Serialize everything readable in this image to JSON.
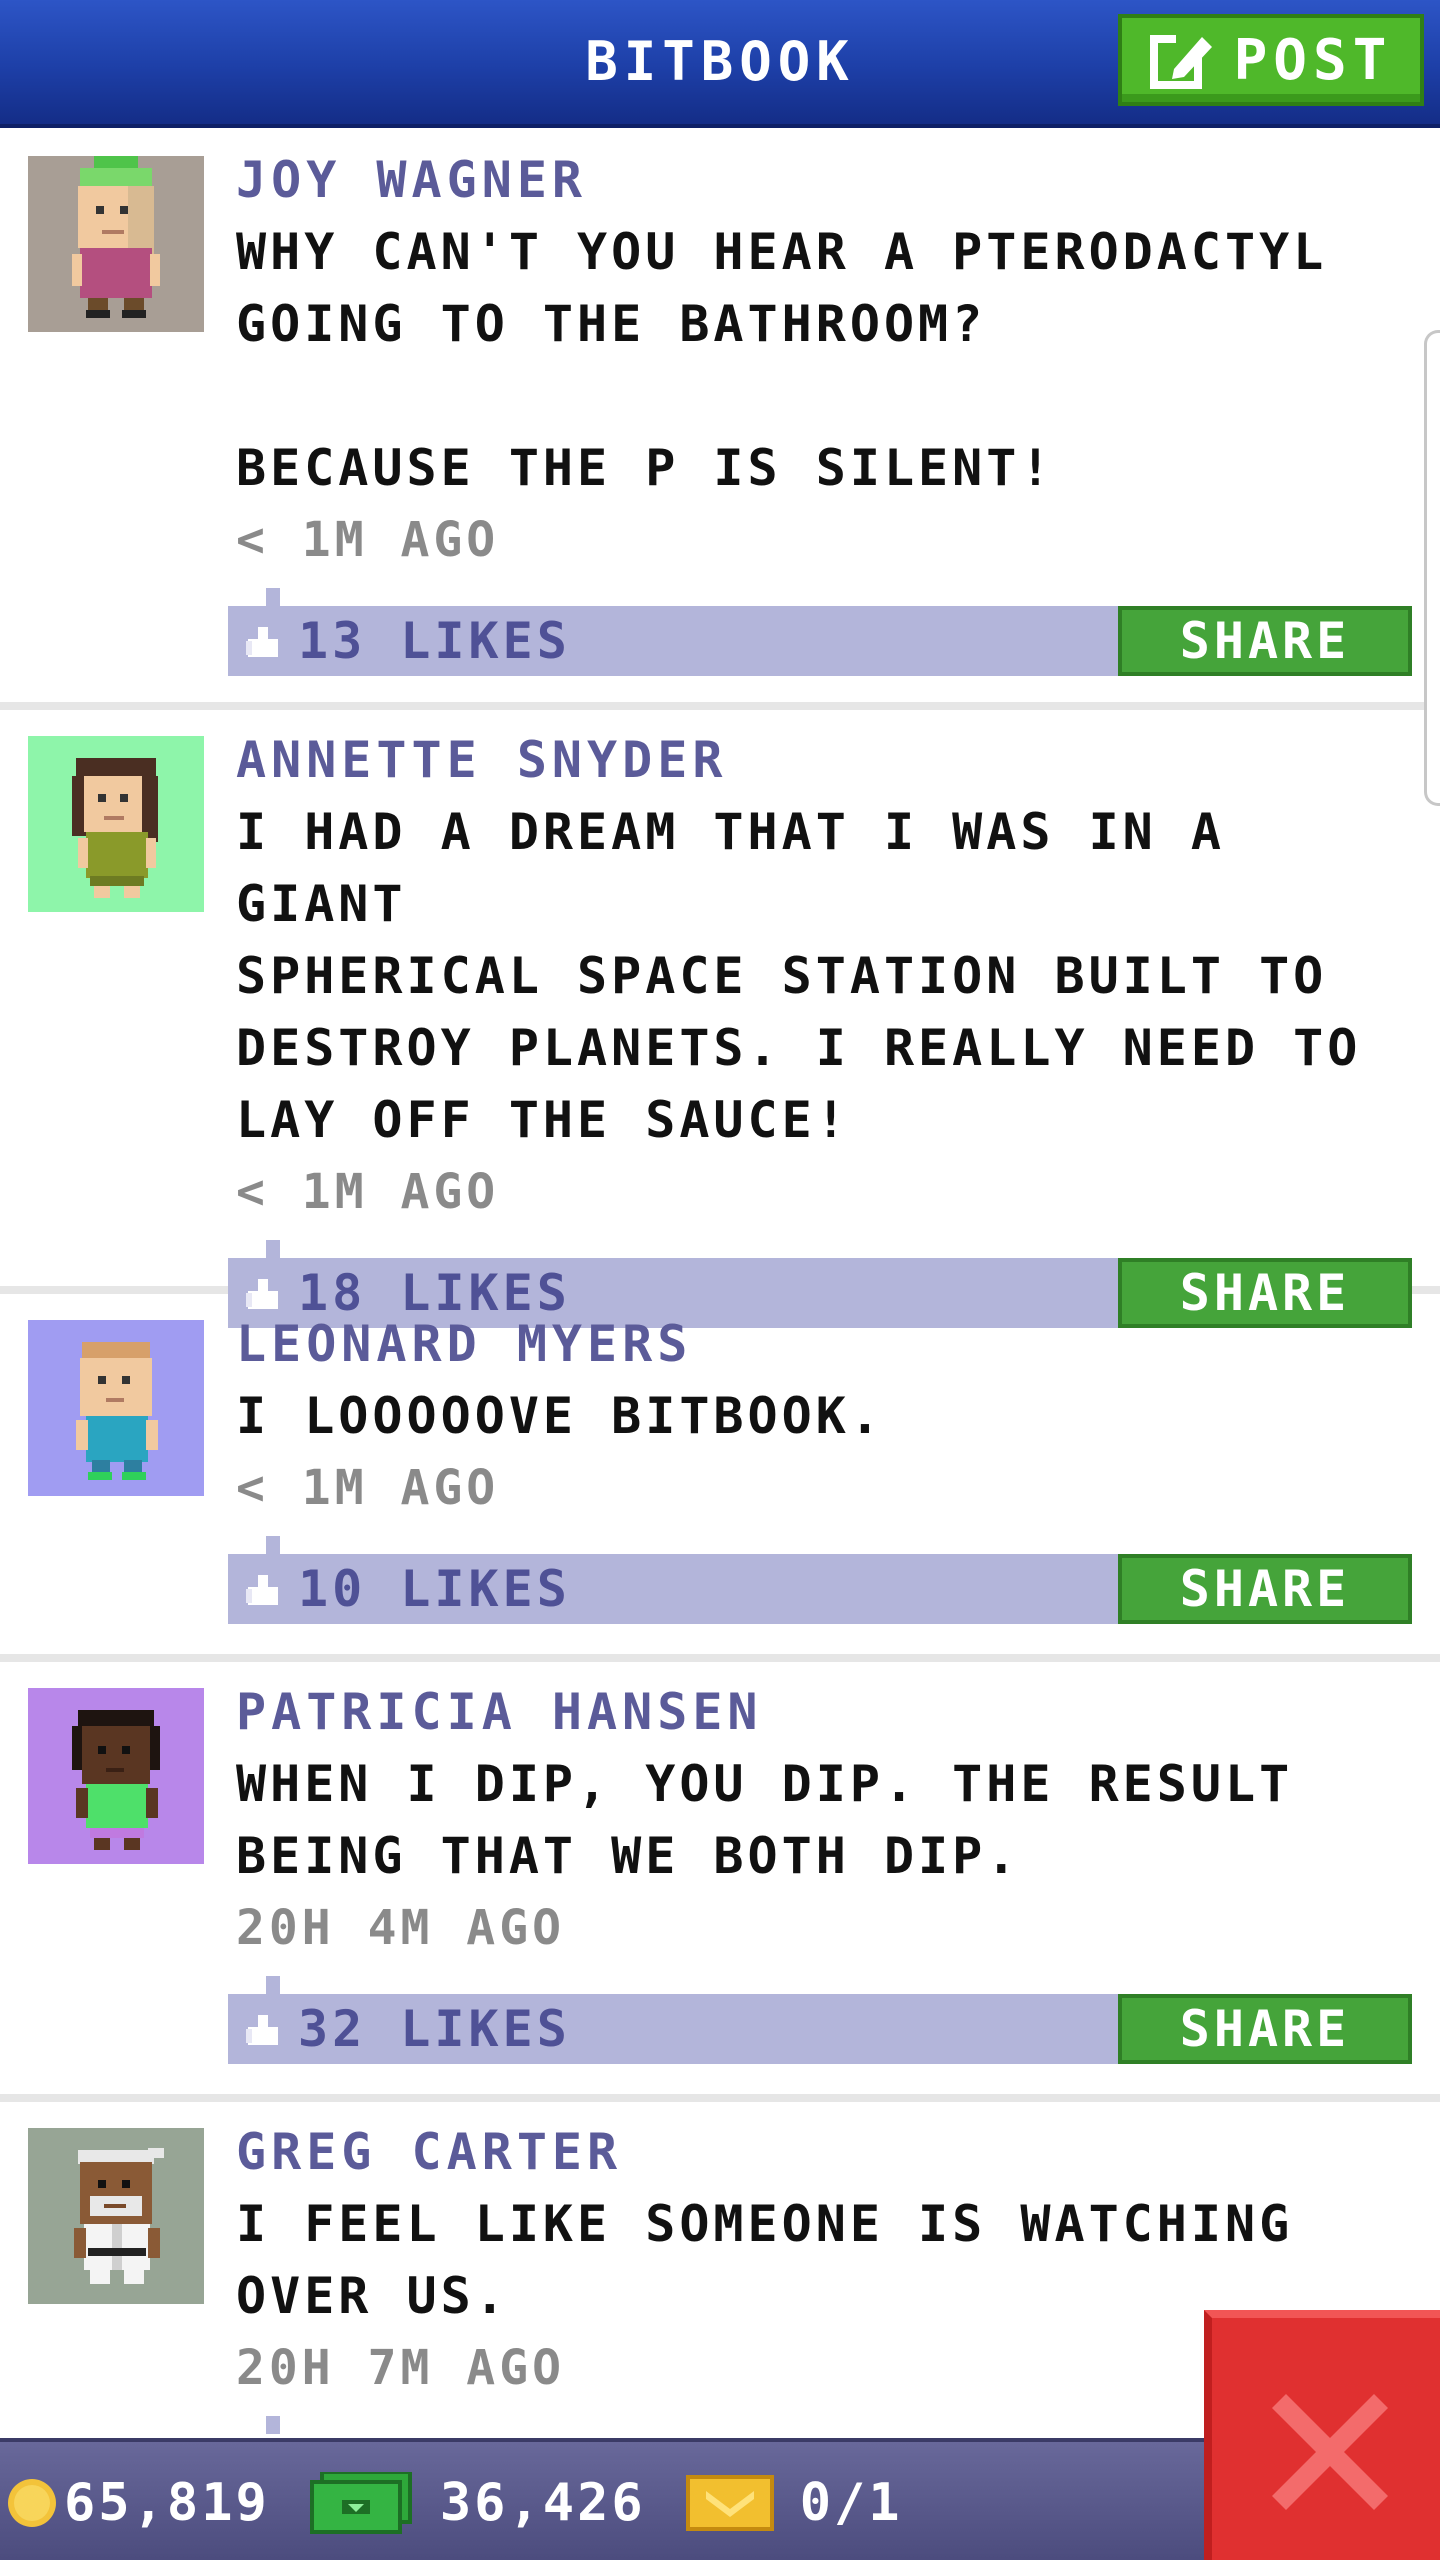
{
  "header": {
    "title": "BITBOOK",
    "post_label": "POST"
  },
  "posts": [
    {
      "author": "JOY WAGNER",
      "message": "WHY CAN'T YOU HEAR A PTERODACTYL\nGOING TO THE BATHROOM?\n\nBECAUSE THE P IS SILENT!",
      "time": "< 1M AGO",
      "likes": "13 LIKES",
      "share_label": "SHARE",
      "avatar_bg": "#a89e95"
    },
    {
      "author": "ANNETTE SNYDER",
      "message": "I HAD A DREAM THAT I WAS IN A GIANT\nSPHERICAL SPACE STATION BUILT TO\nDESTROY PLANETS. I REALLY NEED TO\nLAY OFF THE SAUCE!",
      "time": "< 1M AGO",
      "likes": "18 LIKES",
      "share_label": "SHARE",
      "avatar_bg": "#8ef5aa"
    },
    {
      "author": "LEONARD MYERS",
      "message": "I LOOOOOVE BITBOOK.",
      "time": "< 1M AGO",
      "likes": "10 LIKES",
      "share_label": "SHARE",
      "avatar_bg": "#a09cf2"
    },
    {
      "author": "PATRICIA HANSEN",
      "message": "WHEN I DIP, YOU DIP. THE RESULT\nBEING THAT WE BOTH DIP.",
      "time": "20H 4M AGO",
      "likes": "32 LIKES",
      "share_label": "SHARE",
      "avatar_bg": "#b887ea"
    },
    {
      "author": "GREG CARTER",
      "message": "I FEEL LIKE SOMEONE IS WATCHING\nOVER US.",
      "time": "20H 7M AGO",
      "likes": "",
      "share_label": "",
      "avatar_bg": "#97a595"
    }
  ],
  "status_bar": {
    "coins": "65,819",
    "bux": "36,426",
    "tickets": "0/1"
  },
  "colors": {
    "header_blue": "#1d3fa7",
    "post_green": "#4fb82a",
    "share_green": "#45a43a",
    "likes_bar": "#b3b5da",
    "close_red": "#e03030"
  },
  "icons": {
    "post": "edit-icon",
    "like": "thumbs-up-icon",
    "coin": "coin-icon",
    "bux": "cash-icon",
    "ticket": "ticket-icon",
    "close": "close-icon"
  }
}
